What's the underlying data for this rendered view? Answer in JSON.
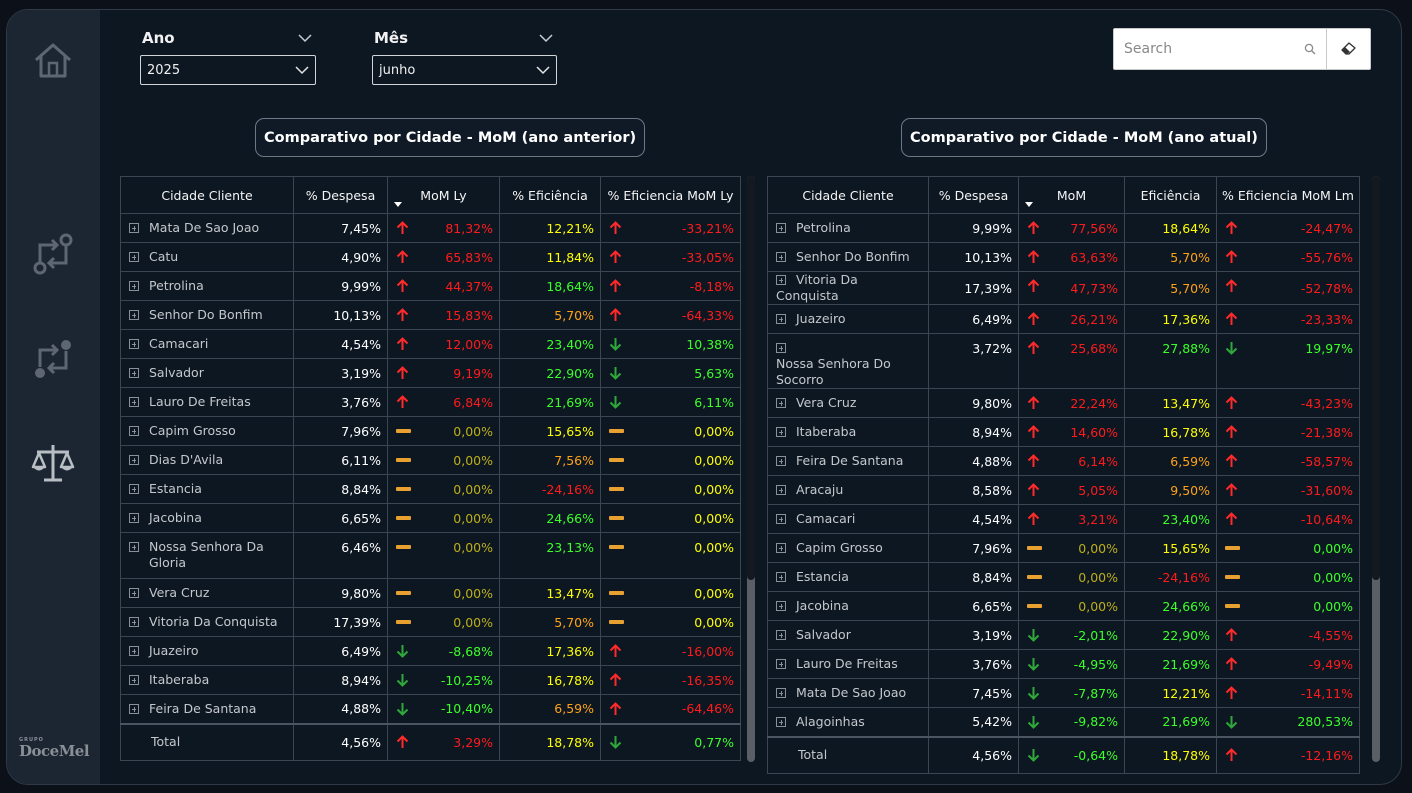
{
  "filters": {
    "ano": {
      "label": "Ano",
      "value": "2025"
    },
    "mes": {
      "label": "Mês",
      "value": "junho"
    }
  },
  "search": {
    "placeholder": "Search"
  },
  "sidebar": {
    "logo_small": "GRUPO",
    "logo": "DoceMel"
  },
  "icons": {
    "up": "arrow-up-icon",
    "down": "arrow-down-icon",
    "flat": "dash-icon"
  },
  "colors": {
    "red": "#ff1b1b",
    "green": "#3cff2a",
    "yellow": "#ffff00",
    "orange": "#ffa218",
    "olive": "#bcae1a"
  },
  "left": {
    "title": "Comparativo por Cidade - MoM (ano anterior)",
    "headers": [
      "Cidade Cliente",
      "% Despesa",
      "MoM Ly",
      "% Eficiência",
      "% Eficiencia MoM Ly"
    ],
    "rows": [
      {
        "city": "Mata De Sao Joao",
        "desp": "7,45%",
        "mom_ic": "up",
        "mom": "81,32%",
        "mom_c": "red",
        "ef": "12,21%",
        "ef_c": "yellow",
        "emom_ic": "up",
        "emom": "-33,21%",
        "emom_c": "red"
      },
      {
        "city": "Catu",
        "desp": "4,90%",
        "mom_ic": "up",
        "mom": "65,83%",
        "mom_c": "red",
        "ef": "11,84%",
        "ef_c": "yellow",
        "emom_ic": "up",
        "emom": "-33,05%",
        "emom_c": "red"
      },
      {
        "city": "Petrolina",
        "desp": "9,99%",
        "mom_ic": "up",
        "mom": "44,37%",
        "mom_c": "red",
        "ef": "18,64%",
        "ef_c": "green",
        "emom_ic": "up",
        "emom": "-8,18%",
        "emom_c": "red"
      },
      {
        "city": "Senhor Do Bonfim",
        "desp": "10,13%",
        "mom_ic": "up",
        "mom": "15,83%",
        "mom_c": "red",
        "ef": "5,70%",
        "ef_c": "orange",
        "emom_ic": "up",
        "emom": "-64,33%",
        "emom_c": "red"
      },
      {
        "city": "Camacari",
        "desp": "4,54%",
        "mom_ic": "up",
        "mom": "12,00%",
        "mom_c": "red",
        "ef": "23,40%",
        "ef_c": "green",
        "emom_ic": "down",
        "emom": "10,38%",
        "emom_c": "green"
      },
      {
        "city": "Salvador",
        "desp": "3,19%",
        "mom_ic": "up",
        "mom": "9,19%",
        "mom_c": "red",
        "ef": "22,90%",
        "ef_c": "green",
        "emom_ic": "down",
        "emom": "5,63%",
        "emom_c": "green"
      },
      {
        "city": "Lauro De Freitas",
        "desp": "3,76%",
        "mom_ic": "up",
        "mom": "6,84%",
        "mom_c": "red",
        "ef": "21,69%",
        "ef_c": "green",
        "emom_ic": "down",
        "emom": "6,11%",
        "emom_c": "green"
      },
      {
        "city": "Capim Grosso",
        "desp": "7,96%",
        "mom_ic": "flat",
        "mom": "0,00%",
        "mom_c": "olive",
        "ef": "15,65%",
        "ef_c": "yellow",
        "emom_ic": "flat",
        "emom": "0,00%",
        "emom_c": "yellow"
      },
      {
        "city": "Dias D'Avila",
        "desp": "6,11%",
        "mom_ic": "flat",
        "mom": "0,00%",
        "mom_c": "olive",
        "ef": "7,56%",
        "ef_c": "orange",
        "emom_ic": "flat",
        "emom": "0,00%",
        "emom_c": "yellow"
      },
      {
        "city": "Estancia",
        "desp": "8,84%",
        "mom_ic": "flat",
        "mom": "0,00%",
        "mom_c": "olive",
        "ef": "-24,16%",
        "ef_c": "red",
        "emom_ic": "flat",
        "emom": "0,00%",
        "emom_c": "yellow"
      },
      {
        "city": "Jacobina",
        "desp": "6,65%",
        "mom_ic": "flat",
        "mom": "0,00%",
        "mom_c": "olive",
        "ef": "24,66%",
        "ef_c": "green",
        "emom_ic": "flat",
        "emom": "0,00%",
        "emom_c": "yellow"
      },
      {
        "city": "Nossa Senhora Da Gloria",
        "desp": "6,46%",
        "mom_ic": "flat",
        "mom": "0,00%",
        "mom_c": "olive",
        "ef": "23,13%",
        "ef_c": "green",
        "emom_ic": "flat",
        "emom": "0,00%",
        "emom_c": "yellow",
        "tall": true
      },
      {
        "city": "Vera Cruz",
        "desp": "9,80%",
        "mom_ic": "flat",
        "mom": "0,00%",
        "mom_c": "olive",
        "ef": "13,47%",
        "ef_c": "yellow",
        "emom_ic": "flat",
        "emom": "0,00%",
        "emom_c": "yellow"
      },
      {
        "city": "Vitoria Da Conquista",
        "desp": "17,39%",
        "mom_ic": "flat",
        "mom": "0,00%",
        "mom_c": "olive",
        "ef": "5,70%",
        "ef_c": "orange",
        "emom_ic": "flat",
        "emom": "0,00%",
        "emom_c": "yellow"
      },
      {
        "city": "Juazeiro",
        "desp": "6,49%",
        "mom_ic": "down",
        "mom": "-8,68%",
        "mom_c": "green",
        "ef": "17,36%",
        "ef_c": "yellow",
        "emom_ic": "up",
        "emom": "-16,00%",
        "emom_c": "red"
      },
      {
        "city": "Itaberaba",
        "desp": "8,94%",
        "mom_ic": "down",
        "mom": "-10,25%",
        "mom_c": "green",
        "ef": "16,78%",
        "ef_c": "yellow",
        "emom_ic": "up",
        "emom": "-16,35%",
        "emom_c": "red"
      },
      {
        "city": "Feira De Santana",
        "desp": "4,88%",
        "mom_ic": "down",
        "mom": "-10,40%",
        "mom_c": "green",
        "ef": "6,59%",
        "ef_c": "orange",
        "emom_ic": "up",
        "emom": "-64,46%",
        "emom_c": "red"
      }
    ],
    "total": {
      "city": "Total",
      "desp": "4,56%",
      "mom_ic": "up",
      "mom": "3,29%",
      "mom_c": "red",
      "ef": "18,78%",
      "ef_c": "yellow",
      "emom_ic": "down",
      "emom": "0,77%",
      "emom_c": "green"
    }
  },
  "right": {
    "title": "Comparativo por Cidade - MoM (ano atual)",
    "headers": [
      "Cidade Cliente",
      "% Despesa",
      "MoM",
      "Eficiência",
      "% Eficiencia MoM Lm"
    ],
    "rows": [
      {
        "city": "Petrolina",
        "desp": "9,99%",
        "mom_ic": "up",
        "mom": "77,56%",
        "mom_c": "red",
        "ef": "18,64%",
        "ef_c": "yellow",
        "emom_ic": "up",
        "emom": "-24,47%",
        "emom_c": "red"
      },
      {
        "city": "Senhor Do Bonfim",
        "desp": "10,13%",
        "mom_ic": "up",
        "mom": "63,63%",
        "mom_c": "red",
        "ef": "5,70%",
        "ef_c": "orange",
        "emom_ic": "up",
        "emom": "-55,76%",
        "emom_c": "red"
      },
      {
        "city": "Vitoria Da Conquista",
        "desp": "17,39%",
        "mom_ic": "up",
        "mom": "47,73%",
        "mom_c": "red",
        "ef": "5,70%",
        "ef_c": "orange",
        "emom_ic": "up",
        "emom": "-52,78%",
        "emom_c": "red"
      },
      {
        "city": "Juazeiro",
        "desp": "6,49%",
        "mom_ic": "up",
        "mom": "26,21%",
        "mom_c": "red",
        "ef": "17,36%",
        "ef_c": "yellow",
        "emom_ic": "up",
        "emom": "-23,33%",
        "emom_c": "red"
      },
      {
        "city": "Nossa Senhora Do Socorro",
        "desp": "3,72%",
        "mom_ic": "up",
        "mom": "25,68%",
        "mom_c": "red",
        "ef": "27,88%",
        "ef_c": "green",
        "emom_ic": "down",
        "emom": "19,97%",
        "emom_c": "green",
        "tall": true
      },
      {
        "city": "Vera Cruz",
        "desp": "9,80%",
        "mom_ic": "up",
        "mom": "22,24%",
        "mom_c": "red",
        "ef": "13,47%",
        "ef_c": "yellow",
        "emom_ic": "up",
        "emom": "-43,23%",
        "emom_c": "red"
      },
      {
        "city": "Itaberaba",
        "desp": "8,94%",
        "mom_ic": "up",
        "mom": "14,60%",
        "mom_c": "red",
        "ef": "16,78%",
        "ef_c": "yellow",
        "emom_ic": "up",
        "emom": "-21,38%",
        "emom_c": "red"
      },
      {
        "city": "Feira De Santana",
        "desp": "4,88%",
        "mom_ic": "up",
        "mom": "6,14%",
        "mom_c": "red",
        "ef": "6,59%",
        "ef_c": "orange",
        "emom_ic": "up",
        "emom": "-58,57%",
        "emom_c": "red"
      },
      {
        "city": "Aracaju",
        "desp": "8,58%",
        "mom_ic": "up",
        "mom": "5,05%",
        "mom_c": "red",
        "ef": "9,50%",
        "ef_c": "orange",
        "emom_ic": "up",
        "emom": "-31,60%",
        "emom_c": "red"
      },
      {
        "city": "Camacari",
        "desp": "4,54%",
        "mom_ic": "up",
        "mom": "3,21%",
        "mom_c": "red",
        "ef": "23,40%",
        "ef_c": "green",
        "emom_ic": "up",
        "emom": "-10,64%",
        "emom_c": "red"
      },
      {
        "city": "Capim Grosso",
        "desp": "7,96%",
        "mom_ic": "flat",
        "mom": "0,00%",
        "mom_c": "olive",
        "ef": "15,65%",
        "ef_c": "yellow",
        "emom_ic": "flat",
        "emom": "0,00%",
        "emom_c": "green"
      },
      {
        "city": "Estancia",
        "desp": "8,84%",
        "mom_ic": "flat",
        "mom": "0,00%",
        "mom_c": "olive",
        "ef": "-24,16%",
        "ef_c": "red",
        "emom_ic": "flat",
        "emom": "0,00%",
        "emom_c": "green"
      },
      {
        "city": "Jacobina",
        "desp": "6,65%",
        "mom_ic": "flat",
        "mom": "0,00%",
        "mom_c": "olive",
        "ef": "24,66%",
        "ef_c": "green",
        "emom_ic": "flat",
        "emom": "0,00%",
        "emom_c": "green"
      },
      {
        "city": "Salvador",
        "desp": "3,19%",
        "mom_ic": "down",
        "mom": "-2,01%",
        "mom_c": "green",
        "ef": "22,90%",
        "ef_c": "green",
        "emom_ic": "up",
        "emom": "-4,55%",
        "emom_c": "red"
      },
      {
        "city": "Lauro De Freitas",
        "desp": "3,76%",
        "mom_ic": "down",
        "mom": "-4,95%",
        "mom_c": "green",
        "ef": "21,69%",
        "ef_c": "green",
        "emom_ic": "up",
        "emom": "-9,49%",
        "emom_c": "red"
      },
      {
        "city": "Mata De Sao Joao",
        "desp": "7,45%",
        "mom_ic": "down",
        "mom": "-7,87%",
        "mom_c": "green",
        "ef": "12,21%",
        "ef_c": "yellow",
        "emom_ic": "up",
        "emom": "-14,11%",
        "emom_c": "red"
      },
      {
        "city": "Alagoinhas",
        "desp": "5,42%",
        "mom_ic": "down",
        "mom": "-9,82%",
        "mom_c": "green",
        "ef": "21,69%",
        "ef_c": "green",
        "emom_ic": "down",
        "emom": "280,53%",
        "emom_c": "green"
      }
    ],
    "total": {
      "city": "Total",
      "desp": "4,56%",
      "mom_ic": "down",
      "mom": "-0,64%",
      "mom_c": "green",
      "ef": "18,78%",
      "ef_c": "yellow",
      "emom_ic": "up",
      "emom": "-12,16%",
      "emom_c": "red"
    }
  }
}
